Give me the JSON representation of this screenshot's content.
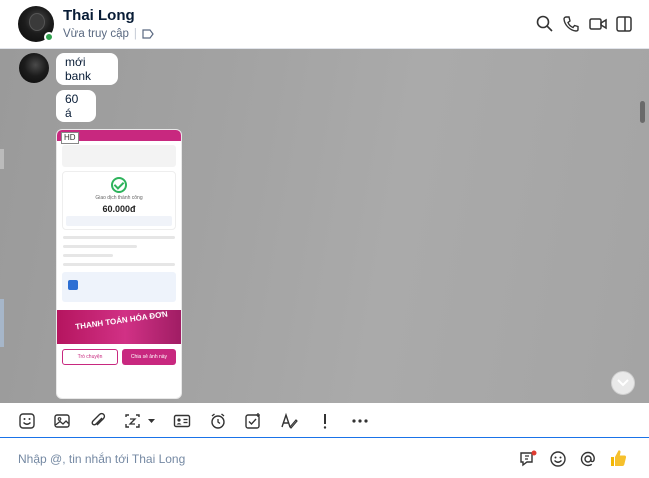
{
  "header": {
    "name": "Thai Long",
    "status": "Vừa truy cập",
    "status_separator": "|"
  },
  "messages": [
    {
      "text": "mới bank"
    },
    {
      "text": "60 á"
    }
  ],
  "attachment": {
    "quality_tag": "HD",
    "receipt_amount": "60.000đ",
    "receipt_title": "Giao dịch thành công",
    "button_left": "Trò chuyện",
    "button_right": "Chia sẻ ảnh này",
    "promo_text": "THANH TOÁN HÓA ĐƠN"
  },
  "input": {
    "placeholder": "Nhập @, tin nhắn tới Thai Long"
  },
  "colors": {
    "accent": "#1a73e8",
    "online": "#30a14e",
    "brand_pink": "#c8287f"
  },
  "icons": {
    "header": [
      "search-icon",
      "phone-icon",
      "video-call-icon",
      "sidebar-toggle-icon"
    ],
    "toolbar": [
      "sticker-icon",
      "image-icon",
      "attachment-icon",
      "screenshot-icon",
      "contact-card-icon",
      "reminder-icon",
      "todo-icon",
      "format-text-icon",
      "important-icon",
      "more-icon"
    ],
    "input": [
      "quick-message-icon",
      "emoji-icon",
      "mention-icon",
      "like-icon"
    ]
  }
}
